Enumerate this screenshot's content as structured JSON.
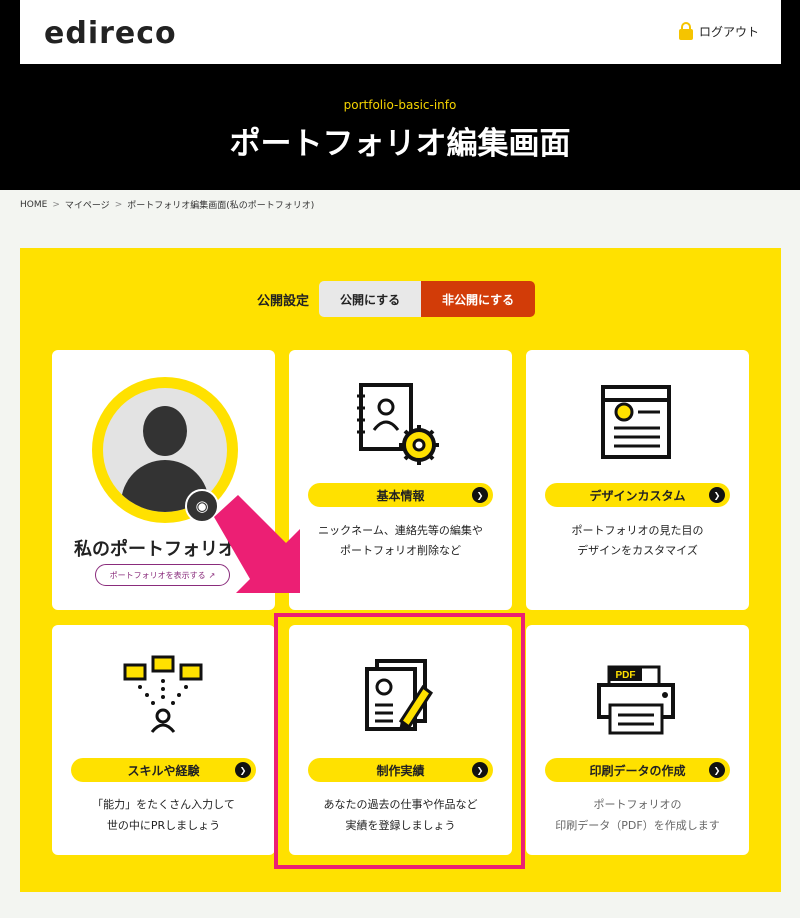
{
  "header": {
    "logo_text": "edireco",
    "logout_label": "ログアウト",
    "subtitle": "portfolio-basic-info",
    "title": "ポートフォリオ編集画面"
  },
  "breadcrumb": {
    "items": [
      "HOME",
      "マイページ",
      "ポートフォリオ編集画面(私のポートフォリオ)"
    ],
    "separator": ">"
  },
  "visibility": {
    "label": "公開設定",
    "public_label": "公開にする",
    "private_label": "非公開にする",
    "selected": "非公開にする"
  },
  "profile_card": {
    "title": "私のポートフォリオ",
    "view_button_label": "ポートフォリオを表示する",
    "camera_icon": "camera-icon"
  },
  "cards": [
    {
      "label": "基本情報",
      "desc_line1": "ニックネーム、連絡先等の編集や",
      "desc_line2": "ポートフォリオ削除など",
      "icon": "profile-settings-icon"
    },
    {
      "label": "デザインカスタム",
      "desc_line1": "ポートフォリオの見た目の",
      "desc_line2": "デザインをカスタマイズ",
      "icon": "design-page-icon"
    },
    {
      "label": "スキルや経験",
      "desc_line1": "「能力」をたくさん入力して",
      "desc_line2": "世の中にPRしましょう",
      "icon": "skills-network-icon"
    },
    {
      "label": "制作実績",
      "desc_line1": "あなたの過去の仕事や作品など",
      "desc_line2": "実績を登録しましょう",
      "icon": "works-document-icon"
    },
    {
      "label": "印刷データの作成",
      "desc_line1": "ポートフォリオの",
      "desc_line2": "印刷データ（PDF）を作成します",
      "icon": "pdf-printer-icon"
    }
  ],
  "printer_badge": "PDF",
  "colors": {
    "accent_yellow": "#ffe100",
    "private_red": "#d23c08",
    "highlight_pink": "#ec1f74",
    "header_black": "#000000"
  }
}
